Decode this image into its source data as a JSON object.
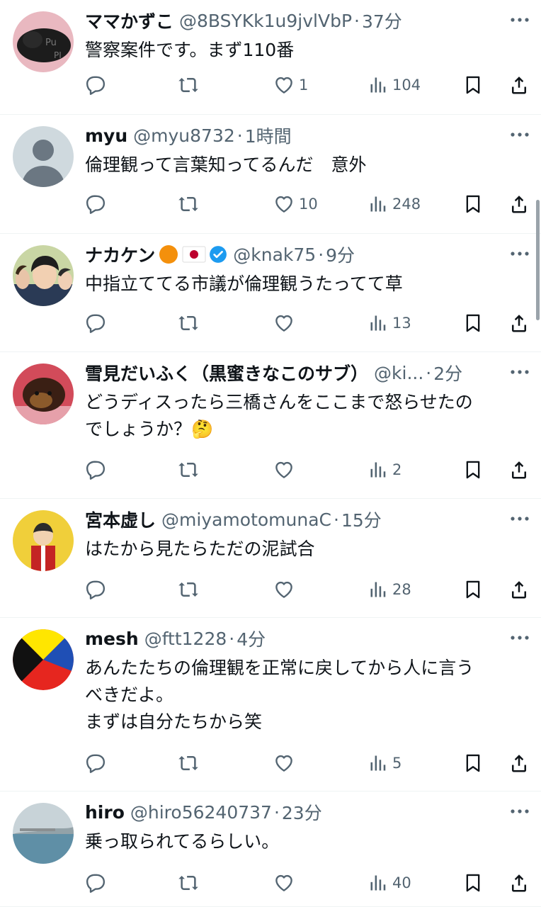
{
  "replies": [
    {
      "name": "ママかずこ",
      "handle": "@8BSYKk1u9jvlVbP",
      "time": "37分",
      "lines": [
        "警察案件です。まず110番"
      ],
      "likes": "1",
      "views": "104",
      "avatar": "dark-dog-photo"
    },
    {
      "name": "myu",
      "handle": "@myu8732",
      "time": "1時間",
      "lines": [
        "倫理観って言葉知ってるんだ　意外"
      ],
      "likes": "10",
      "views": "248",
      "avatar": "default-avatar"
    },
    {
      "name": "ナカケン",
      "handle": "@knak75",
      "time": "9分",
      "lines": [
        "中指立ててる市議が倫理観うたってて草"
      ],
      "likes": "",
      "views": "13",
      "avatar": "anime-boy",
      "emojis": [
        "orange-circle-emoji",
        "japan-flag-emoji",
        "verified-badge-icon"
      ]
    },
    {
      "name": "雪見だいふく（黒蜜きなこのサブ）",
      "handle": "@ki...",
      "time": "2分",
      "lines": [
        "どうディスったら三橋さんをここまで怒らせたの",
        "でしょうか？🤔"
      ],
      "likes": "",
      "views": "2",
      "avatar": "small-dog-photo"
    },
    {
      "name": "宮本虚し",
      "handle": "@miyamotomunaC",
      "time": "15分",
      "lines": [
        "はたから見たらただの泥試合"
      ],
      "likes": "",
      "views": "28",
      "avatar": "samurai-illustration"
    },
    {
      "name": "mesh",
      "handle": "@ftt1228",
      "time": "4分",
      "lines": [
        "あんたたちの倫理観を正常に戻してから人に言う",
        "べきだよ。",
        "まずは自分たちから笑"
      ],
      "likes": "",
      "views": "5",
      "avatar": "color-wedges"
    },
    {
      "name": "hiro",
      "handle": "@hiro56240737",
      "time": "23分",
      "lines": [
        "乗っ取られてるらしい。"
      ],
      "likes": "",
      "views": "40",
      "avatar": "coastline-photo"
    }
  ],
  "icons": {
    "reply": "reply-bubble-icon",
    "retweet": "retweet-icon",
    "like": "heart-icon",
    "views": "analytics-bars-icon",
    "bookmark": "bookmark-icon",
    "share": "share-upload-icon",
    "more": "more-dots-icon"
  },
  "colors": {
    "text": "#0f1419",
    "secondary": "#536471",
    "divider": "#eff3f4",
    "verified": "#1d9bf0"
  }
}
